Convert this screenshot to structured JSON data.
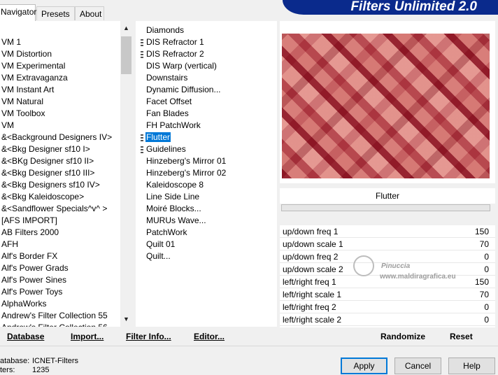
{
  "tabs": [
    "Navigator",
    "Presets",
    "About"
  ],
  "app_title": "Filters Unlimited 2.0",
  "categories": [
    "VM 1",
    "VM Distortion",
    "VM Experimental",
    "VM Extravaganza",
    "VM Instant Art",
    "VM Natural",
    "VM Toolbox",
    "VM",
    "&<Background Designers IV>",
    "&<Bkg Designer sf10 I>",
    "&<BKg Designer sf10 II>",
    "&<Bkg Designer sf10 III>",
    "&<Bkg Designers sf10 IV>",
    "&<Bkg Kaleidoscope>",
    "&<Sandflower Specials^v^ >",
    "[AFS IMPORT]",
    "AB Filters 2000",
    "AFH",
    "Alf's Border FX",
    "Alf's Power Grads",
    "Alf's Power Sines",
    "Alf's Power Toys",
    "AlphaWorks",
    "Andrew's Filter Collection 55",
    "Andrew's Filter Collection 56"
  ],
  "filters": [
    {
      "name": "Diamonds",
      "marked": false
    },
    {
      "name": "DIS Refractor 1",
      "marked": true
    },
    {
      "name": "DIS Refractor 2",
      "marked": true
    },
    {
      "name": "DIS Warp (vertical)",
      "marked": false
    },
    {
      "name": "Downstairs",
      "marked": false
    },
    {
      "name": "Dynamic Diffusion...",
      "marked": false
    },
    {
      "name": "Facet Offset",
      "marked": false
    },
    {
      "name": "Fan Blades",
      "marked": false
    },
    {
      "name": "FH PatchWork",
      "marked": false
    },
    {
      "name": "Flutter",
      "marked": true,
      "selected": true
    },
    {
      "name": "Guidelines",
      "marked": true
    },
    {
      "name": "Hinzeberg's Mirror 01",
      "marked": false
    },
    {
      "name": "Hinzeberg's Mirror 02",
      "marked": false
    },
    {
      "name": "Kaleidoscope 8",
      "marked": false
    },
    {
      "name": "Line Side Line",
      "marked": false
    },
    {
      "name": "Moiré Blocks...",
      "marked": false
    },
    {
      "name": "MURUs Wave...",
      "marked": false
    },
    {
      "name": "PatchWork",
      "marked": false
    },
    {
      "name": "Quilt 01",
      "marked": false
    },
    {
      "name": "Quilt...",
      "marked": false
    }
  ],
  "selected_filter": "Flutter",
  "params": [
    {
      "label": "up/down freq 1",
      "value": "150"
    },
    {
      "label": "up/down scale 1",
      "value": "70"
    },
    {
      "label": "up/down freq 2",
      "value": "0"
    },
    {
      "label": "up/down scale 2",
      "value": "0"
    },
    {
      "label": "left/right freq 1",
      "value": "150"
    },
    {
      "label": "left/right scale 1",
      "value": "70"
    },
    {
      "label": "left/right freq 2",
      "value": "0"
    },
    {
      "label": "left/right scale 2",
      "value": "0"
    }
  ],
  "watermark": {
    "name": "Pinuccia",
    "url": "www.maldiragrafica.eu"
  },
  "actions": {
    "database": "Database",
    "import": "Import...",
    "filter_info": "Filter Info...",
    "editor": "Editor...",
    "randomize": "Randomize",
    "reset": "Reset"
  },
  "info": {
    "db_label": "atabase:",
    "db_value": "ICNET-Filters",
    "filters_label": "ters:",
    "filters_value": "1235"
  },
  "buttons": {
    "apply": "Apply",
    "cancel": "Cancel",
    "help": "Help"
  },
  "colors": {
    "selection": "#0078d7",
    "banner": "#0a2a8c",
    "preview_red": "#c05a5e"
  }
}
